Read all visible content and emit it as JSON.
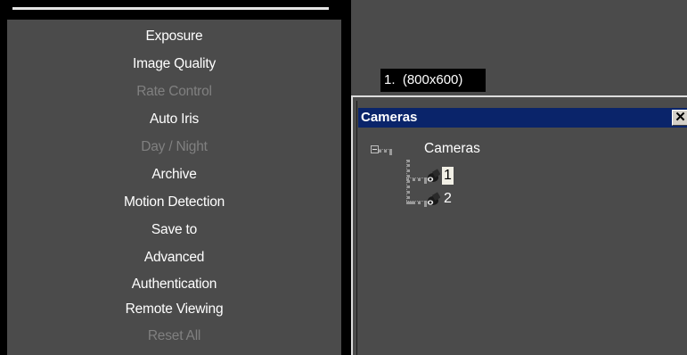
{
  "menu": {
    "items": [
      {
        "label": "Exposure",
        "enabled": true
      },
      {
        "label": "Image Quality",
        "enabled": true
      },
      {
        "label": "Rate Control",
        "enabled": false
      },
      {
        "label": "Auto Iris",
        "enabled": true
      },
      {
        "label": "Day / Night",
        "enabled": false
      },
      {
        "label": "Archive",
        "enabled": true
      },
      {
        "label": "Motion Detection",
        "enabled": true
      },
      {
        "label": "Save to",
        "enabled": true
      },
      {
        "label": "Advanced",
        "enabled": true
      },
      {
        "label": "Authentication",
        "enabled": true
      },
      {
        "label": "Remote Viewing",
        "enabled": true
      },
      {
        "label": "Reset All",
        "enabled": false
      }
    ]
  },
  "video": {
    "channel_label": "1.  (800x600)"
  },
  "cameras_window": {
    "title": "Cameras",
    "close_label": "✕",
    "tree": {
      "root_label": "Cameras",
      "nodes": [
        {
          "label": "1",
          "selected": true,
          "icon": "camera-icon"
        },
        {
          "label": "2",
          "selected": false,
          "icon": "camera-icon"
        }
      ]
    }
  },
  "colors": {
    "panel_bg": "#4b4b4b",
    "title_bar": "#0a246a",
    "disabled_text": "#808080",
    "selection_bg": "#f2f0e6"
  }
}
